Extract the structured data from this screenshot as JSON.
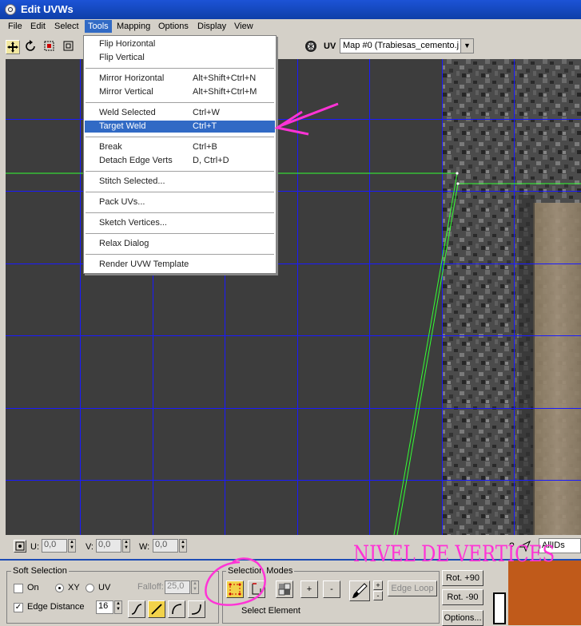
{
  "window": {
    "title": "Edit UVWs"
  },
  "menubar": {
    "items": [
      "File",
      "Edit",
      "Select",
      "Tools",
      "Mapping",
      "Options",
      "Display",
      "View"
    ],
    "active": "Tools"
  },
  "toolbar": {
    "uv_label": "UV",
    "map_select_value": "Map #0 (Trabiesas_cemento.j"
  },
  "tools_menu": {
    "groups": [
      [
        {
          "label": "Flip Horizontal",
          "shortcut": ""
        },
        {
          "label": "Flip Vertical",
          "shortcut": ""
        }
      ],
      [
        {
          "label": "Mirror Horizontal",
          "shortcut": "Alt+Shift+Ctrl+N"
        },
        {
          "label": "Mirror Vertical",
          "shortcut": "Alt+Shift+Ctrl+M"
        }
      ],
      [
        {
          "label": "Weld Selected",
          "shortcut": "Ctrl+W"
        },
        {
          "label": "Target Weld",
          "shortcut": "Ctrl+T"
        }
      ],
      [
        {
          "label": "Break",
          "shortcut": "Ctrl+B"
        },
        {
          "label": "Detach Edge Verts",
          "shortcut": "D, Ctrl+D"
        }
      ],
      [
        {
          "label": "Stitch Selected...",
          "shortcut": ""
        }
      ],
      [
        {
          "label": "Pack UVs...",
          "shortcut": ""
        }
      ],
      [
        {
          "label": "Sketch Vertices...",
          "shortcut": ""
        }
      ],
      [
        {
          "label": "Relax Dialog",
          "shortcut": ""
        }
      ],
      [
        {
          "label": "Render UVW Template",
          "shortcut": ""
        }
      ]
    ],
    "highlighted": "Target Weld"
  },
  "coords": {
    "u_label": "U:",
    "u_value": "0,0",
    "v_label": "V:",
    "v_value": "0,0",
    "w_label": "W:",
    "w_value": "0,0",
    "filter_value": "AllIDs"
  },
  "soft_selection": {
    "title": "Soft Selection",
    "on_label": "On",
    "on_checked": false,
    "xy_label": "XY",
    "uv_label": "UV",
    "mode": "XY",
    "falloff_label": "Falloff:",
    "falloff_value": "25,0",
    "edge_distance_label": "Edge Distance",
    "edge_distance_checked": true,
    "edge_distance_value": "16"
  },
  "selection_modes": {
    "title": "Selection Modes",
    "plus_label": "+",
    "minus_label": "-",
    "edge_loop_label": "Edge Loop",
    "select_element_label": "Select Element"
  },
  "rotate": {
    "plus90": "Rot. +90",
    "minus90": "Rot. -90",
    "options": "Options..."
  },
  "annotation": {
    "text": "NIVEL DE VERTICES",
    "color": "#ff33d6"
  },
  "colors": {
    "title_bar": "#0e3fa8",
    "menu_highlight": "#316ac5",
    "grid_line": "#1a1aff",
    "uv_edge": "#33ff33",
    "viewport_bg": "#3d3d3d"
  }
}
